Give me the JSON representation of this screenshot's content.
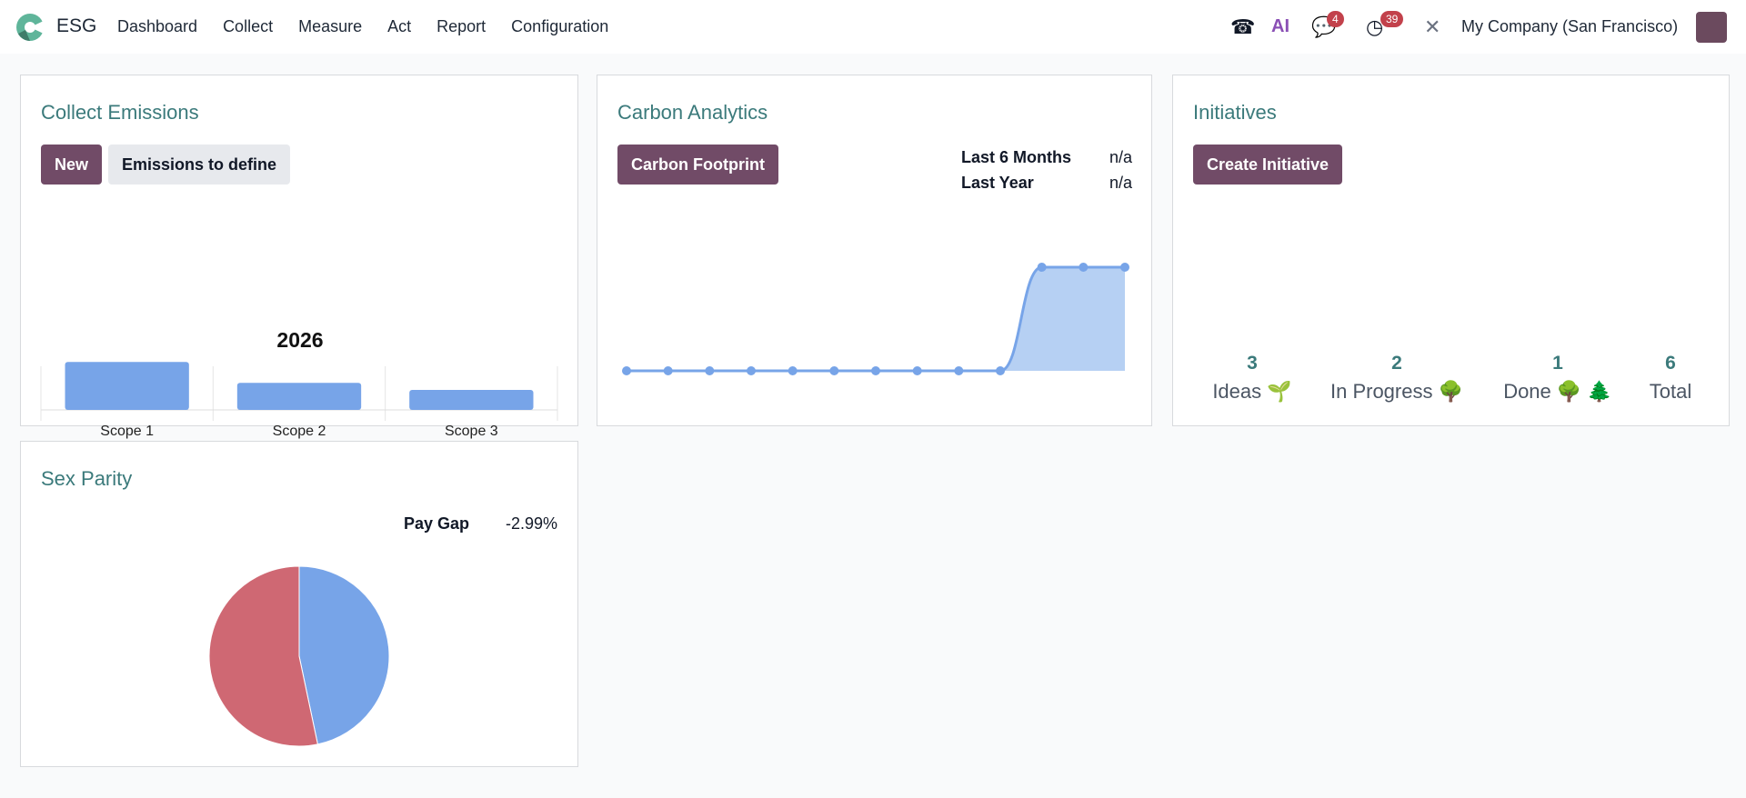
{
  "nav": {
    "app": "ESG",
    "menu": [
      "Dashboard",
      "Collect",
      "Measure",
      "Act",
      "Report",
      "Configuration"
    ],
    "ai_label": "AI",
    "messages_badge": "4",
    "activities_badge": "39",
    "company": "My Company (San Francisco)"
  },
  "collect": {
    "title": "Collect Emissions",
    "new_label": "New",
    "define_label": "Emissions to define",
    "chart_data": {
      "type": "bar",
      "title": "2026",
      "categories": [
        "Scope 1",
        "Scope 2",
        "Scope 3"
      ],
      "values": [
        115,
        65,
        48
      ],
      "color": "#77a4e8"
    }
  },
  "carbon": {
    "title": "Carbon Analytics",
    "button": "Carbon Footprint",
    "stats": [
      {
        "label": "Last 6 Months",
        "value": "n/a"
      },
      {
        "label": "Last Year",
        "value": "n/a"
      }
    ],
    "chart_data": {
      "type": "area",
      "x": [
        1,
        2,
        3,
        4,
        5,
        6,
        7,
        8,
        9,
        10,
        11,
        12,
        13
      ],
      "values": [
        0,
        0,
        0,
        0,
        0,
        0,
        0,
        0,
        0,
        0,
        1,
        1,
        1
      ],
      "color": "#77a4e8"
    }
  },
  "initiatives": {
    "title": "Initiatives",
    "button": "Create Initiative",
    "stats": [
      {
        "count": "3",
        "label": "Ideas",
        "icon": "🌱"
      },
      {
        "count": "2",
        "label": "In Progress",
        "icon": "🌳"
      },
      {
        "count": "1",
        "label": "Done",
        "icon": "🌳 🌲"
      },
      {
        "count": "6",
        "label": "Total",
        "icon": ""
      }
    ]
  },
  "parity": {
    "title": "Sex Parity",
    "pay_gap_label": "Pay Gap",
    "pay_gap_value": "-2.99%",
    "chart_data": {
      "type": "pie",
      "slices": [
        {
          "name": "blue",
          "value": 46.7,
          "color": "#77a4e8"
        },
        {
          "name": "red",
          "value": 53.3,
          "color": "#cf6873"
        }
      ]
    }
  }
}
